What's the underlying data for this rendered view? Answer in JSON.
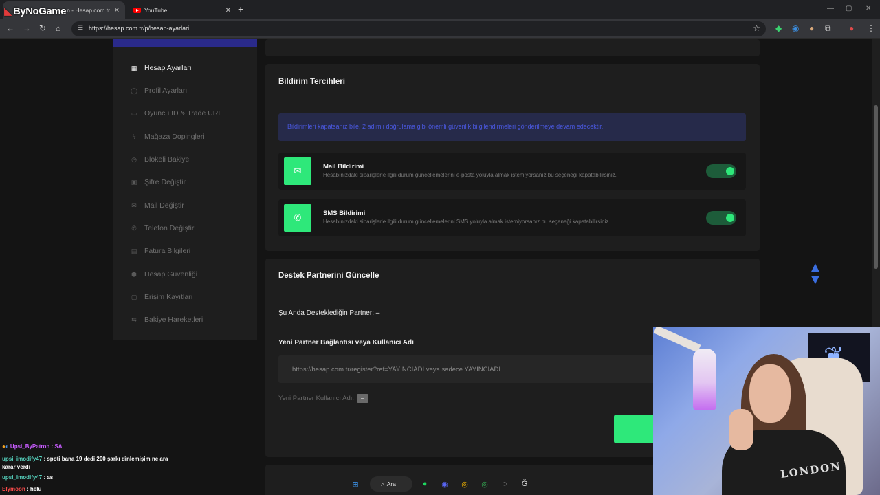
{
  "browser": {
    "brand": "ByNoGame",
    "tabs": [
      {
        "label": "...n - Hesap.com.tr"
      },
      {
        "label": "YouTube"
      }
    ],
    "url": "https://hesap.com.tr/p/hesap-ayarlari"
  },
  "sidebar": {
    "items": [
      {
        "label": "Hesap Ayarları",
        "icon": "grid-icon"
      },
      {
        "label": "Profil Ayarları",
        "icon": "user-icon"
      },
      {
        "label": "Oyuncu ID & Trade URL",
        "icon": "gamepad-icon"
      },
      {
        "label": "Mağaza Dopingleri",
        "icon": "bolt-icon"
      },
      {
        "label": "Blokeli Bakiye",
        "icon": "clock-icon"
      },
      {
        "label": "Şifre Değiştir",
        "icon": "lock-icon"
      },
      {
        "label": "Mail Değiştir",
        "icon": "mail-icon"
      },
      {
        "label": "Telefon Değiştir",
        "icon": "phone-icon"
      },
      {
        "label": "Fatura Bilgileri",
        "icon": "invoice-icon"
      },
      {
        "label": "Hesap Güvenliği",
        "icon": "shield-icon"
      },
      {
        "label": "Erişim Kayıtları",
        "icon": "log-icon"
      },
      {
        "label": "Bakiye Hareketleri",
        "icon": "transfer-icon"
      }
    ]
  },
  "notifications": {
    "title": "Bildirim Tercihleri",
    "info": "Bildirimleri kapatsanız bile, 2 adımlı doğrulama gibi önemli güvenlik bilgilendirmeleri gönderilmeye devam edecektir.",
    "mail": {
      "title": "Mail Bildirimi",
      "desc": "Hesabınızdaki siparişlerle ilgili durum güncellemelerini e-posta yoluyla almak istemiyorsanız bu seçeneği kapatabilirsiniz.",
      "enabled": true
    },
    "sms": {
      "title": "SMS Bildirimi",
      "desc": "Hesabınızdaki siparişlerle ilgili durum güncellemelerini SMS yoluyla almak istemiyorsanız bu seçeneği kapatabilirsiniz.",
      "enabled": true
    }
  },
  "partner": {
    "title": "Destek Partnerini Güncelle",
    "current": "Şu Anda Desteklediğin Partner: –",
    "new_label": "Yeni Partner Bağlantısı veya Kullanıcı Adı",
    "placeholder": "https://hesap.com.tr/register?ref=YAYINCIADI veya sadece YAYINCIADI",
    "username_label": "Yeni Partner Kullanıcı Adı:",
    "username_value": "–"
  },
  "chat": [
    {
      "user": "Upsi_ByPatron",
      "msg": "SA"
    },
    {
      "user": "upsi_imodify47",
      "msg": "spoti bana 19 dedi 200 şarkı dinlemişim ne ara karar verdi"
    },
    {
      "user": "upsi_imodify47",
      "msg": "as"
    },
    {
      "user": "Elymoon",
      "msg": "helü"
    }
  ],
  "taskbar": {
    "search_label": "Ara"
  },
  "webcam": {
    "shirt_text": "LONDON"
  },
  "colors": {
    "accent": "#2ee87a",
    "info_bg": "#262a4a",
    "info_text": "#4a58e0"
  }
}
